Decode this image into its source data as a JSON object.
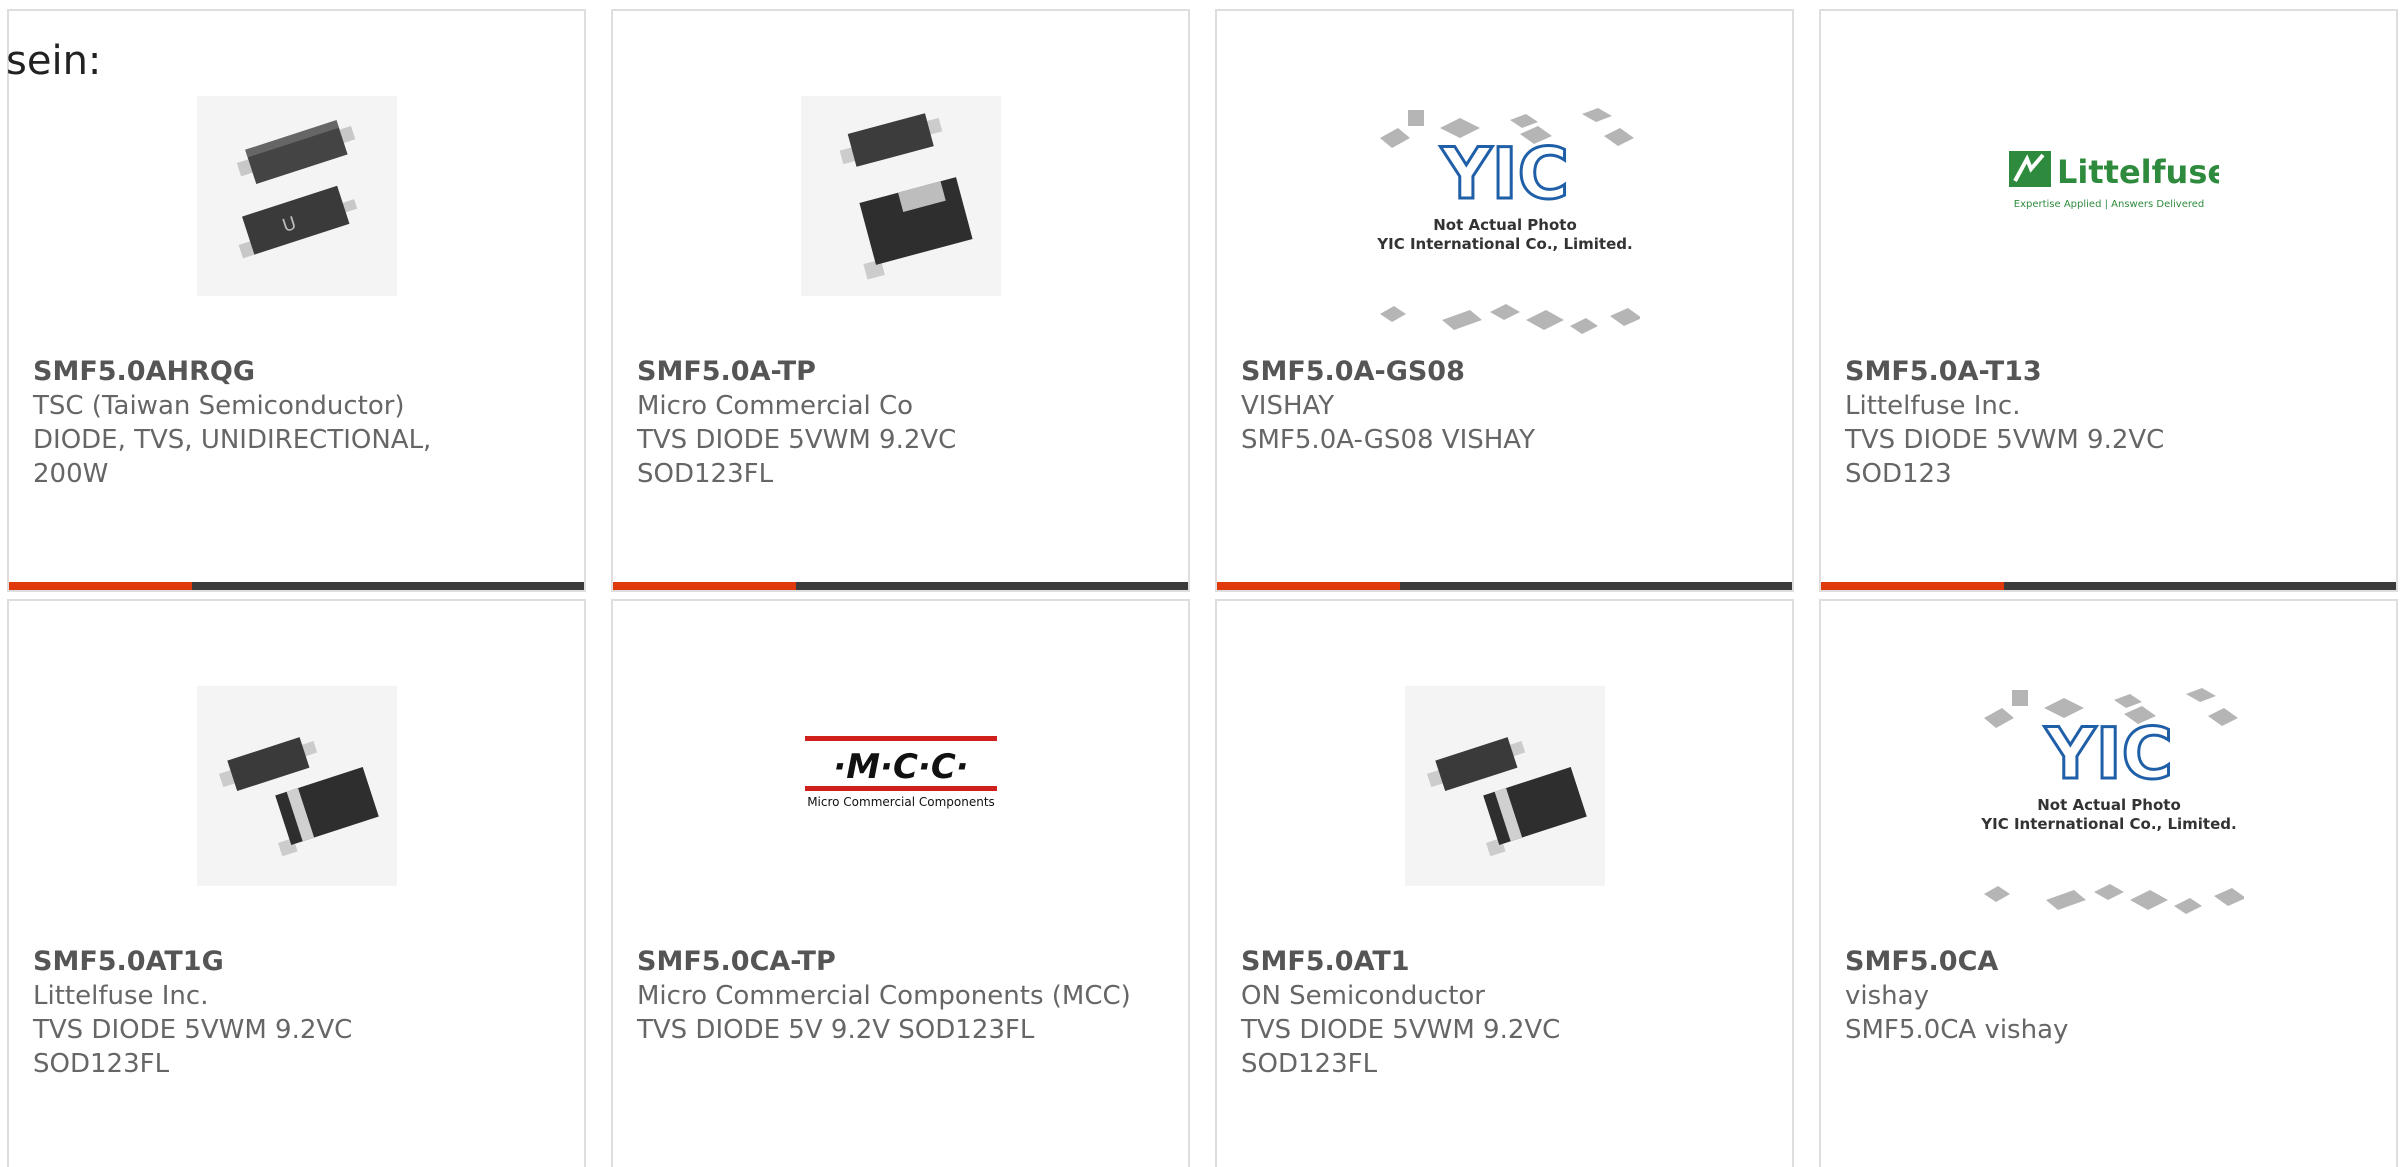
{
  "intro_text": "sein:",
  "colors": {
    "accent": "#e03a0c",
    "bar": "#3b3b3b",
    "border": "#dedede",
    "text": "#666666"
  },
  "products": [
    {
      "part_number": "SMF5.0AHRQG",
      "manufacturer": "TSC (Taiwan Semiconductor)",
      "description": "DIODE, TVS, UNIDIRECTIONAL, 200W",
      "image": "diode-photo"
    },
    {
      "part_number": "SMF5.0A-TP",
      "manufacturer": "Micro Commercial Co",
      "description": "TVS DIODE 5VWM 9.2VC SOD123FL",
      "image": "diode-photo"
    },
    {
      "part_number": "SMF5.0A-GS08",
      "manufacturer": "VISHAY",
      "description": "SMF5.0A-GS08 VISHAY",
      "image": "yic-placeholder"
    },
    {
      "part_number": "SMF5.0A-T13",
      "manufacturer": "Littelfuse Inc.",
      "description": "TVS DIODE 5VWM 9.2VC SOD123",
      "image": "littelfuse-logo"
    },
    {
      "part_number": "SMF5.0AT1G",
      "manufacturer": "Littelfuse Inc.",
      "description": "TVS DIODE 5VWM 9.2VC SOD123FL",
      "image": "diode-photo"
    },
    {
      "part_number": "SMF5.0CA-TP",
      "manufacturer": "Micro Commercial Components (MCC)",
      "description": "TVS DIODE 5V 9.2V SOD123FL",
      "image": "mcc-logo"
    },
    {
      "part_number": "SMF5.0AT1",
      "manufacturer": "ON Semiconductor",
      "description": "TVS DIODE 5VWM 9.2VC SOD123FL",
      "image": "diode-photo"
    },
    {
      "part_number": "SMF5.0CA",
      "manufacturer": "vishay",
      "description": "SMF5.0CA vishay",
      "image": "yic-placeholder"
    }
  ],
  "image_text": {
    "yic_logo": "YIC",
    "yic_line1": "Not Actual Photo",
    "yic_line2": "YIC International Co., Limited.",
    "littelfuse_name": "Littelfuse",
    "littelfuse_tagline": "Expertise Applied | Answers Delivered",
    "mcc_name": "·M·C·C·",
    "mcc_tagline": "Micro Commercial Components"
  }
}
